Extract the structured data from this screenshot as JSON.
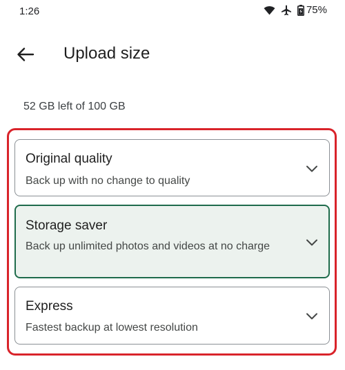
{
  "status_bar": {
    "time": "1:26",
    "battery_percent": "75%",
    "icons": [
      "wifi-icon",
      "airplane-icon",
      "battery-icon"
    ]
  },
  "app_bar": {
    "back_icon": "arrow-back-icon",
    "title": "Upload size"
  },
  "storage": {
    "summary": "52 GB left of 100 GB"
  },
  "options": [
    {
      "title": "Original quality",
      "description": "Back up with no change to quality",
      "selected": false
    },
    {
      "title": "Storage saver",
      "description": "Back up unlimited photos and videos at no charge",
      "selected": true
    },
    {
      "title": "Express",
      "description": "Fastest backup at lowest resolution",
      "selected": false
    }
  ],
  "colors": {
    "selected_background": "#ecf2ee",
    "selected_border": "#1e6b4b",
    "highlight_frame": "#d9232a"
  }
}
